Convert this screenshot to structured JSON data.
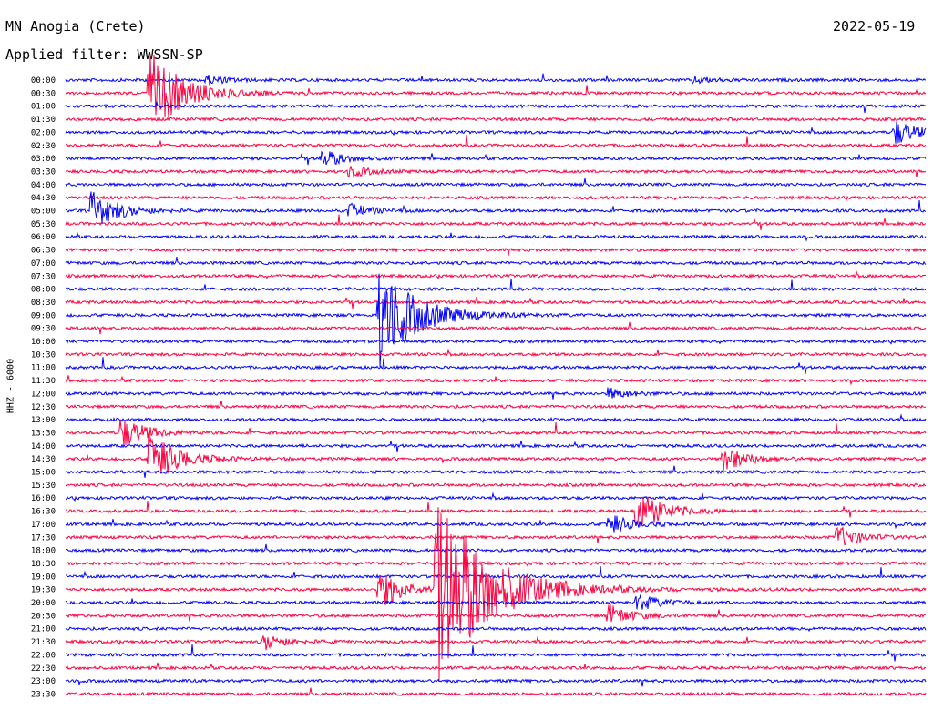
{
  "header": {
    "station": "MN Anogia (Crete)",
    "date": "2022-05-19",
    "filter_label": "Applied filter:",
    "filter_value": "WWSSN-SP"
  },
  "channel_label": "HHZ - 6000",
  "chart_data": {
    "type": "seismogram",
    "rows": [
      "00:00",
      "00:30",
      "01:00",
      "01:30",
      "02:00",
      "02:30",
      "03:00",
      "03:30",
      "04:00",
      "04:30",
      "05:00",
      "05:30",
      "06:00",
      "06:30",
      "07:00",
      "07:30",
      "08:00",
      "08:30",
      "09:00",
      "09:30",
      "10:00",
      "10:30",
      "11:00",
      "11:30",
      "12:00",
      "12:30",
      "13:00",
      "13:30",
      "14:00",
      "14:30",
      "15:00",
      "15:30",
      "16:00",
      "16:30",
      "17:00",
      "17:30",
      "18:00",
      "18:30",
      "19:00",
      "19:30",
      "20:00",
      "20:30",
      "21:00",
      "21:30",
      "22:00",
      "22:30",
      "23:00",
      "23:30"
    ],
    "colors": [
      "#0000ff",
      "#ff0040"
    ],
    "row_minutes": 30,
    "events": [
      {
        "row": "00:30",
        "minute": 3,
        "amp": 4
      },
      {
        "row": "00:00",
        "minute": 5,
        "amp": 0.4
      },
      {
        "row": "00:00",
        "minute": 22,
        "amp": 0.3
      },
      {
        "row": "02:00",
        "minute": 29,
        "amp": 1.2
      },
      {
        "row": "03:00",
        "minute": 9,
        "amp": 0.8
      },
      {
        "row": "03:30",
        "minute": 10,
        "amp": 0.5
      },
      {
        "row": "05:00",
        "minute": 1,
        "amp": 1.8
      },
      {
        "row": "05:00",
        "minute": 10,
        "amp": 0.6
      },
      {
        "row": "09:00",
        "minute": 11,
        "amp": 5
      },
      {
        "row": "12:00",
        "minute": 19,
        "amp": 0.5
      },
      {
        "row": "13:30",
        "minute": 2,
        "amp": 1.5
      },
      {
        "row": "14:30",
        "minute": 3,
        "amp": 2.5
      },
      {
        "row": "14:30",
        "minute": 23,
        "amp": 1.2
      },
      {
        "row": "16:30",
        "minute": 20,
        "amp": 2
      },
      {
        "row": "17:00",
        "minute": 19,
        "amp": 1
      },
      {
        "row": "17:30",
        "minute": 27,
        "amp": 1
      },
      {
        "row": "19:30",
        "minute": 11,
        "amp": 1.8
      },
      {
        "row": "19:30",
        "minute": 13,
        "amp": 9
      },
      {
        "row": "20:00",
        "minute": 20,
        "amp": 0.8
      },
      {
        "row": "20:30",
        "minute": 19,
        "amp": 1
      },
      {
        "row": "21:30",
        "minute": 7,
        "amp": 0.7
      }
    ]
  }
}
